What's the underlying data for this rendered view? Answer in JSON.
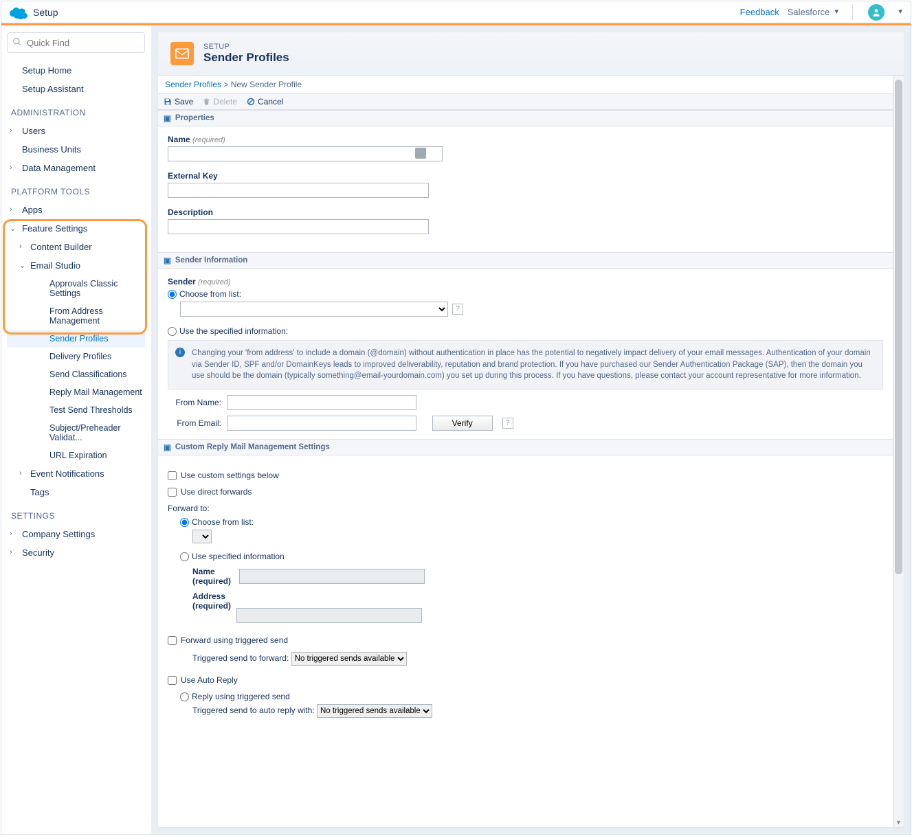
{
  "topbar": {
    "app": "Setup",
    "feedback": "Feedback",
    "org": "Salesforce"
  },
  "sidebar": {
    "quickfind_placeholder": "Quick Find",
    "setup_home": "Setup Home",
    "setup_assistant": "Setup Assistant",
    "sec_admin": "ADMINISTRATION",
    "users": "Users",
    "business_units": "Business Units",
    "data_mgmt": "Data Management",
    "sec_platform": "PLATFORM TOOLS",
    "apps": "Apps",
    "feature_settings": "Feature Settings",
    "content_builder": "Content Builder",
    "email_studio": "Email Studio",
    "es": {
      "approvals": "Approvals Classic Settings",
      "from_addr": "From Address Management",
      "sender_profiles": "Sender Profiles",
      "delivery_profiles": "Delivery Profiles",
      "send_class": "Send Classifications",
      "reply_mail": "Reply Mail Management",
      "test_send": "Test Send Thresholds",
      "subj_pre": "Subject/Preheader Validat...",
      "url_exp": "URL Expiration"
    },
    "event_notif": "Event Notifications",
    "tags": "Tags",
    "sec_settings": "SETTINGS",
    "company_settings": "Company Settings",
    "security": "Security"
  },
  "header": {
    "sup": "SETUP",
    "title": "Sender Profiles"
  },
  "breadcrumb": {
    "parent": "Sender Profiles",
    "current": "New Sender Profile"
  },
  "toolbar": {
    "save": "Save",
    "delete": "Delete",
    "cancel": "Cancel"
  },
  "sections": {
    "properties": "Properties",
    "sender_info": "Sender Information",
    "custom_reply": "Custom Reply Mail Management Settings"
  },
  "fields": {
    "name": "Name",
    "required": "(required)",
    "external_key": "External Key",
    "description": "Description",
    "sender": "Sender",
    "choose_list": "Choose from list:",
    "use_specified": "Use the specified information:",
    "info_text": "Changing your 'from address' to include a domain (@domain) without authentication in place has the potential to negatively impact delivery of your email messages. Authentication of your domain via Sender ID, SPF and/or DomainKeys leads to improved deliverability, reputation and brand protection. If you have purchased our Sender Authentication Package (SAP), then the domain you use should be the domain (typically something@email-yourdomain.com) you set up during this process. If you have questions, please contact your account representative for more information.",
    "from_name": "From Name:",
    "from_email": "From Email:",
    "verify": "Verify",
    "use_custom": "Use custom settings below",
    "use_direct": "Use direct forwards",
    "forward_to": "Forward to:",
    "use_spec_info": "Use specified information",
    "fwd_name": "Name",
    "fwd_address": "Address",
    "fwd_trig": "Forward using triggered send",
    "trig_fwd_lbl": "Triggered send to forward:",
    "no_trig": "No triggered sends available",
    "use_auto": "Use Auto Reply",
    "reply_trig": "Reply using triggered send",
    "trig_reply_lbl": "Triggered send to auto reply with:"
  }
}
